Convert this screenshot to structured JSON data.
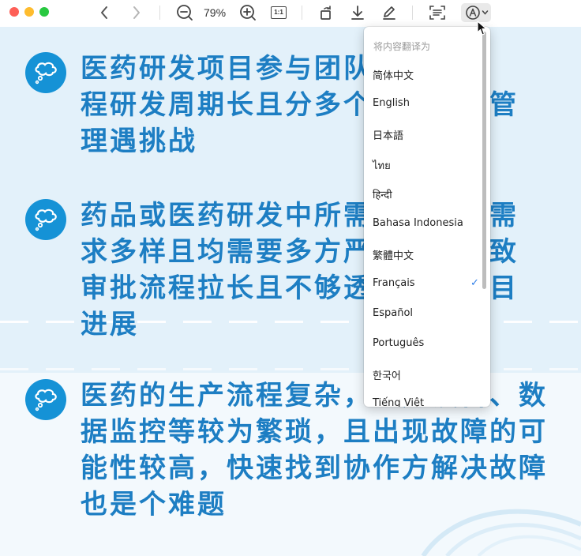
{
  "toolbar": {
    "traffic_lights": [
      "#fe5f57",
      "#febc2e",
      "#28c840"
    ],
    "zoom_label": "79%",
    "actual_size_label": "1:1"
  },
  "page": {
    "bullets": [
      "医药研发项目参与团队众多，全\n程研发周期长且分多个阶段项目管\n理遇挑战",
      "药品或医药研发中所需物资采购需\n求多样且均需要多方严格审批导致\n审批流程拉长且不够透明影响项目\n进展",
      "医药的生产流程复杂，生产设备、数\n据监控等较为繁琐，且出现故障的可\n能性较高，快速找到协作方解决故障\n也是个难题"
    ],
    "accent_color": "#1592d6",
    "text_color": "#1d7ec3"
  },
  "menu": {
    "header": "将内容翻译为",
    "items": [
      {
        "label": "简体中文",
        "checked": false
      },
      {
        "label": "English",
        "checked": false
      },
      {
        "label": "日本語",
        "checked": false
      },
      {
        "label": "ไทย",
        "checked": false
      },
      {
        "label": "हिन्दी",
        "checked": false
      },
      {
        "label": "Bahasa Indonesia",
        "checked": false
      },
      {
        "label": "繁體中文",
        "checked": false
      },
      {
        "label": "Français",
        "checked": true
      },
      {
        "label": "Español",
        "checked": false
      },
      {
        "label": "Português",
        "checked": false
      },
      {
        "label": "한국어",
        "checked": false
      },
      {
        "label": "Tiếng Việt",
        "checked": false
      }
    ],
    "check_glyph": "✓"
  }
}
